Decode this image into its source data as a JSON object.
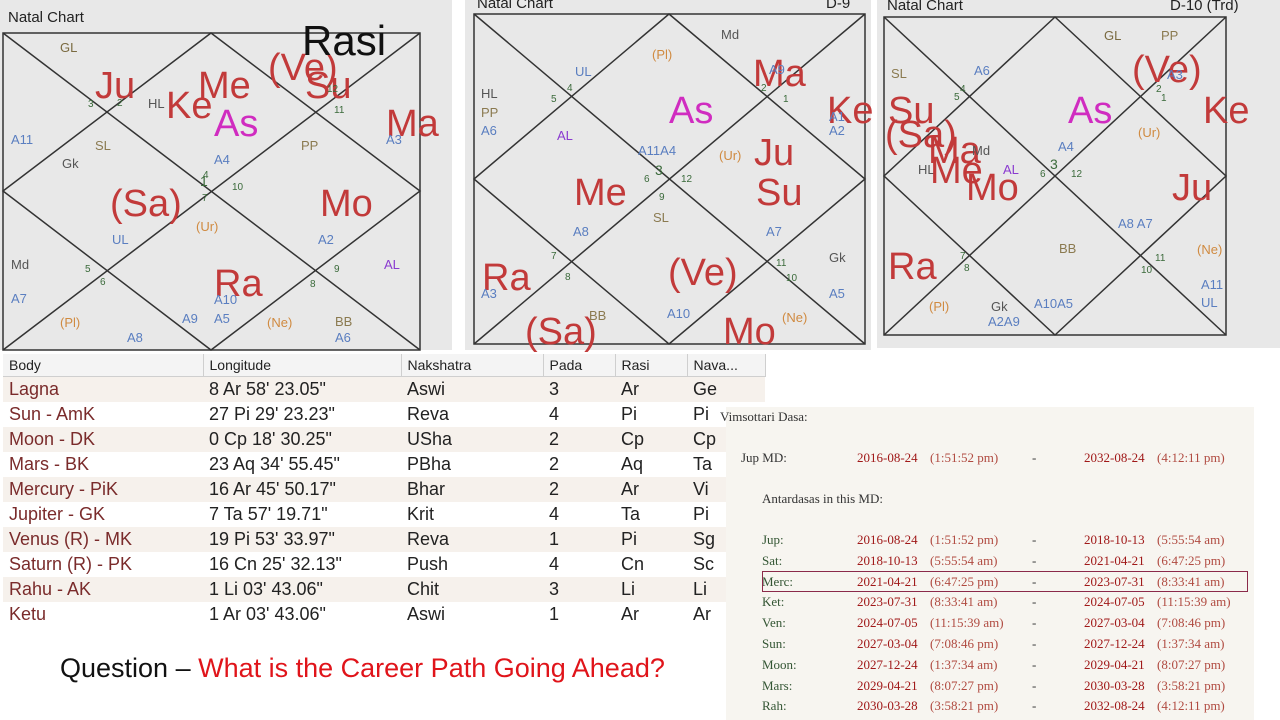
{
  "chart1": {
    "title": "Natal Chart",
    "label": "Rasi",
    "text": [
      {
        "t": "GL",
        "c": "#7a6a40",
        "s": 13
      },
      {
        "t": "Ju",
        "c": "#c23a3a",
        "s": 38
      },
      {
        "t": "Ke",
        "c": "#c23a3a",
        "s": 38
      },
      {
        "t": "Me",
        "c": "#c23a3a",
        "s": 38
      },
      {
        "t": "(Ve)",
        "c": "#c23a3a",
        "s": 38
      },
      {
        "t": "Su",
        "c": "#c23a3a",
        "s": 38
      },
      {
        "t": "As",
        "c": "#d02cc0",
        "s": 38
      },
      {
        "t": "HL",
        "c": "#555555",
        "s": 13
      },
      {
        "t": "3",
        "c": "#3a6a3a",
        "s": 10
      },
      {
        "t": "2",
        "c": "#3a6a3a",
        "s": 10
      },
      {
        "t": "12",
        "c": "#3a6a3a",
        "s": 10
      },
      {
        "t": "11",
        "c": "#3a6a3a",
        "s": 10
      },
      {
        "t": "Ma",
        "c": "#c23a3a",
        "s": 38
      },
      {
        "t": "A3",
        "c": "#5a7ec0",
        "s": 13
      },
      {
        "t": "A11",
        "c": "#5a7ec0",
        "s": 13
      },
      {
        "t": "SL",
        "c": "#8b7a50",
        "s": 13
      },
      {
        "t": "Gk",
        "c": "#555555",
        "s": 13
      },
      {
        "t": "A4",
        "c": "#5a7ec0",
        "s": 13
      },
      {
        "t": "PP",
        "c": "#8b7a50",
        "s": 13
      },
      {
        "t": "1",
        "c": "#3a6a3a",
        "s": 14
      },
      {
        "t": "4",
        "c": "#3a6a3a",
        "s": 10
      },
      {
        "t": "10",
        "c": "#3a6a3a",
        "s": 10
      },
      {
        "t": "7",
        "c": "#3a6a3a",
        "s": 10
      },
      {
        "t": "(Sa)",
        "c": "#c23a3a",
        "s": 38
      },
      {
        "t": "Mo",
        "c": "#c23a3a",
        "s": 38
      },
      {
        "t": "(Ur)",
        "c": "#d08a40",
        "s": 13
      },
      {
        "t": "UL",
        "c": "#5a7ec0",
        "s": 13
      },
      {
        "t": "A2",
        "c": "#5a7ec0",
        "s": 13
      },
      {
        "t": "Md",
        "c": "#555555",
        "s": 13
      },
      {
        "t": "5",
        "c": "#3a6a3a",
        "s": 10
      },
      {
        "t": "6",
        "c": "#3a6a3a",
        "s": 10
      },
      {
        "t": "Ra",
        "c": "#c23a3a",
        "s": 38
      },
      {
        "t": "8",
        "c": "#3a6a3a",
        "s": 10
      },
      {
        "t": "9",
        "c": "#3a6a3a",
        "s": 10
      },
      {
        "t": "AL",
        "c": "#8a3ad0",
        "s": 13
      },
      {
        "t": "A7",
        "c": "#5a7ec0",
        "s": 13
      },
      {
        "t": "A10",
        "c": "#5a7ec0",
        "s": 13
      },
      {
        "t": "(Pl)",
        "c": "#d08a40",
        "s": 13
      },
      {
        "t": "A9",
        "c": "#5a7ec0",
        "s": 13
      },
      {
        "t": "A5",
        "c": "#5a7ec0",
        "s": 13
      },
      {
        "t": "(Ne)",
        "c": "#d08a40",
        "s": 13
      },
      {
        "t": "BB",
        "c": "#8b7a50",
        "s": 13
      },
      {
        "t": "A8",
        "c": "#5a7ec0",
        "s": 13
      },
      {
        "t": "A6",
        "c": "#5a7ec0",
        "s": 13
      }
    ]
  },
  "chart2": {
    "title": "Natal Chart",
    "label": "D-9",
    "text": [
      {
        "t": "Md",
        "c": "#555555",
        "s": 13
      },
      {
        "t": "(Pl)",
        "c": "#d08a40",
        "s": 13
      },
      {
        "t": "Ma",
        "c": "#c23a3a",
        "s": 38
      },
      {
        "t": "A9",
        "c": "#5a7ec0",
        "s": 13
      },
      {
        "t": "UL",
        "c": "#5a7ec0",
        "s": 13
      },
      {
        "t": "HL",
        "c": "#555555",
        "s": 13
      },
      {
        "t": "PP",
        "c": "#8b7a50",
        "s": 13
      },
      {
        "t": "A6",
        "c": "#5a7ec0",
        "s": 13
      },
      {
        "t": "5",
        "c": "#3a6a3a",
        "s": 10
      },
      {
        "t": "4",
        "c": "#3a6a3a",
        "s": 10
      },
      {
        "t": "2",
        "c": "#3a6a3a",
        "s": 10
      },
      {
        "t": "1",
        "c": "#3a6a3a",
        "s": 10
      },
      {
        "t": "As",
        "c": "#d02cc0",
        "s": 38
      },
      {
        "t": "Ke",
        "c": "#c23a3a",
        "s": 38
      },
      {
        "t": "A1",
        "c": "#5a7ec0",
        "s": 13
      },
      {
        "t": "A2",
        "c": "#5a7ec0",
        "s": 13
      },
      {
        "t": "AL",
        "c": "#8a3ad0",
        "s": 13
      },
      {
        "t": "A11A4",
        "c": "#5a7ec0",
        "s": 13
      },
      {
        "t": "(Ur)",
        "c": "#d08a40",
        "s": 13
      },
      {
        "t": "Ju",
        "c": "#c23a3a",
        "s": 38
      },
      {
        "t": "Me",
        "c": "#c23a3a",
        "s": 38
      },
      {
        "t": "6",
        "c": "#3a6a3a",
        "s": 10
      },
      {
        "t": "3",
        "c": "#3a6a3a",
        "s": 14
      },
      {
        "t": "12",
        "c": "#3a6a3a",
        "s": 10
      },
      {
        "t": "Su",
        "c": "#c23a3a",
        "s": 38
      },
      {
        "t": "9",
        "c": "#3a6a3a",
        "s": 10
      },
      {
        "t": "SL",
        "c": "#8b7a50",
        "s": 13
      },
      {
        "t": "A8",
        "c": "#5a7ec0",
        "s": 13
      },
      {
        "t": "A7",
        "c": "#5a7ec0",
        "s": 13
      },
      {
        "t": "Ra",
        "c": "#c23a3a",
        "s": 38
      },
      {
        "t": "7",
        "c": "#3a6a3a",
        "s": 10
      },
      {
        "t": "8",
        "c": "#3a6a3a",
        "s": 10
      },
      {
        "t": "(Ve)",
        "c": "#c23a3a",
        "s": 38
      },
      {
        "t": "11",
        "c": "#3a6a3a",
        "s": 10
      },
      {
        "t": "10",
        "c": "#3a6a3a",
        "s": 10
      },
      {
        "t": "Gk",
        "c": "#555555",
        "s": 13
      },
      {
        "t": "A3",
        "c": "#5a7ec0",
        "s": 13
      },
      {
        "t": "A5",
        "c": "#5a7ec0",
        "s": 13
      },
      {
        "t": "A10",
        "c": "#5a7ec0",
        "s": 13
      },
      {
        "t": "(Sa)",
        "c": "#c23a3a",
        "s": 38
      },
      {
        "t": "BB",
        "c": "#8b7a50",
        "s": 13
      },
      {
        "t": "Mo",
        "c": "#c23a3a",
        "s": 38
      },
      {
        "t": "(Ne)",
        "c": "#d08a40",
        "s": 13
      }
    ]
  },
  "chart3": {
    "title": "Natal Chart",
    "label": "D-10 (Trd)",
    "text": [
      {
        "t": "GL",
        "c": "#7a6a40",
        "s": 13
      },
      {
        "t": "PP",
        "c": "#8b7a50",
        "s": 13
      },
      {
        "t": "SL",
        "c": "#8b7a50",
        "s": 13
      },
      {
        "t": "A6",
        "c": "#5a7ec0",
        "s": 13
      },
      {
        "t": "(Ve)",
        "c": "#c23a3a",
        "s": 38
      },
      {
        "t": "A3",
        "c": "#5a7ec0",
        "s": 13
      },
      {
        "t": "5",
        "c": "#3a6a3a",
        "s": 10
      },
      {
        "t": "4",
        "c": "#3a6a3a",
        "s": 10
      },
      {
        "t": "2",
        "c": "#3a6a3a",
        "s": 10
      },
      {
        "t": "1",
        "c": "#3a6a3a",
        "s": 10
      },
      {
        "t": "As",
        "c": "#d02cc0",
        "s": 38
      },
      {
        "t": "Ke",
        "c": "#c23a3a",
        "s": 38
      },
      {
        "t": "Su",
        "c": "#c23a3a",
        "s": 38
      },
      {
        "t": "(Sa)",
        "c": "#c23a3a",
        "s": 38
      },
      {
        "t": "(Ur)",
        "c": "#d08a40",
        "s": 13
      },
      {
        "t": "Ma",
        "c": "#c23a3a",
        "s": 38
      },
      {
        "t": "Md",
        "c": "#555555",
        "s": 13
      },
      {
        "t": "A4",
        "c": "#5a7ec0",
        "s": 13
      },
      {
        "t": "HL",
        "c": "#555555",
        "s": 13
      },
      {
        "t": "Me",
        "c": "#c23a3a",
        "s": 38
      },
      {
        "t": "Mo",
        "c": "#c23a3a",
        "s": 38
      },
      {
        "t": "AL",
        "c": "#8a3ad0",
        "s": 13
      },
      {
        "t": "6",
        "c": "#3a6a3a",
        "s": 10
      },
      {
        "t": "3",
        "c": "#3a6a3a",
        "s": 14
      },
      {
        "t": "12",
        "c": "#3a6a3a",
        "s": 10
      },
      {
        "t": "Ju",
        "c": "#c23a3a",
        "s": 38
      },
      {
        "t": "A8 A7",
        "c": "#5a7ec0",
        "s": 13
      },
      {
        "t": "BB",
        "c": "#8b7a50",
        "s": 13
      },
      {
        "t": "Ra",
        "c": "#c23a3a",
        "s": 38
      },
      {
        "t": "7",
        "c": "#3a6a3a",
        "s": 10
      },
      {
        "t": "8",
        "c": "#3a6a3a",
        "s": 10
      },
      {
        "t": "10",
        "c": "#3a6a3a",
        "s": 10
      },
      {
        "t": "11",
        "c": "#3a6a3a",
        "s": 10
      },
      {
        "t": "(Ne)",
        "c": "#d08a40",
        "s": 13
      },
      {
        "t": "A11",
        "c": "#5a7ec0",
        "s": 13
      },
      {
        "t": "UL",
        "c": "#5a7ec0",
        "s": 13
      },
      {
        "t": "(Pl)",
        "c": "#d08a40",
        "s": 13
      },
      {
        "t": "Gk",
        "c": "#555555",
        "s": 13
      },
      {
        "t": "A2A9",
        "c": "#5a7ec0",
        "s": 13
      },
      {
        "t": "A10A5",
        "c": "#5a7ec0",
        "s": 13
      }
    ]
  },
  "table": {
    "headers": [
      "Body",
      "Longitude",
      "Nakshatra",
      "Pada",
      "Rasi",
      "Nava..."
    ],
    "rows": [
      [
        "Lagna",
        "8 Ar 58' 23.05\"",
        "Aswi",
        "3",
        "Ar",
        "Ge"
      ],
      [
        "Sun - AmK",
        "27 Pi 29' 23.23\"",
        "Reva",
        "4",
        "Pi",
        "Pi"
      ],
      [
        "Moon - DK",
        "0 Cp 18' 30.25\"",
        "USha",
        "2",
        "Cp",
        "Cp"
      ],
      [
        "Mars - BK",
        "23 Aq 34' 55.45\"",
        "PBha",
        "2",
        "Aq",
        "Ta"
      ],
      [
        "Mercury - PiK",
        "16 Ar 45' 50.17\"",
        "Bhar",
        "2",
        "Ar",
        "Vi"
      ],
      [
        "Jupiter - GK",
        "7 Ta 57' 19.71\"",
        "Krit",
        "4",
        "Ta",
        "Pi"
      ],
      [
        "Venus (R) - MK",
        "19 Pi 53' 33.97\"",
        "Reva",
        "1",
        "Pi",
        "Sg"
      ],
      [
        "Saturn (R) - PK",
        "16 Cn 25' 32.13\"",
        "Push",
        "4",
        "Cn",
        "Sc"
      ],
      [
        "Rahu - AK",
        "1 Li 03' 43.06\"",
        "Chit",
        "3",
        "Li",
        "Li"
      ],
      [
        "Ketu",
        "1 Ar 03' 43.06\"",
        "Aswi",
        "1",
        "Ar",
        "Ar"
      ]
    ]
  },
  "question": {
    "prefix": "Question – ",
    "text": "What is the Career Path Going Ahead?"
  },
  "dasa": {
    "title": "Vimsottari Dasa:",
    "md": [
      "Jup MD:",
      "2016-08-24",
      "(1:51:52 pm)",
      "-",
      "2032-08-24",
      "(4:12:11 pm)"
    ],
    "subtitle": "Antardasas in this MD:",
    "rows": [
      [
        "Jup:",
        "2016-08-24",
        "(1:51:52 pm)",
        "-",
        "2018-10-13",
        "(5:55:54 am)"
      ],
      [
        "Sat:",
        "2018-10-13",
        "(5:55:54 am)",
        "-",
        "2021-04-21",
        "(6:47:25 pm)"
      ],
      [
        "Merc:",
        "2021-04-21",
        "(6:47:25 pm)",
        "-",
        "2023-07-31",
        "(8:33:41 am)"
      ],
      [
        "Ket:",
        "2023-07-31",
        "(8:33:41 am)",
        "-",
        "2024-07-05",
        "(11:15:39 am)"
      ],
      [
        "Ven:",
        "2024-07-05",
        "(11:15:39 am)",
        "-",
        "2027-03-04",
        "(7:08:46 pm)"
      ],
      [
        "Sun:",
        "2027-03-04",
        "(7:08:46 pm)",
        "-",
        "2027-12-24",
        "(1:37:34 am)"
      ],
      [
        "Moon:",
        "2027-12-24",
        "(1:37:34 am)",
        "-",
        "2029-04-21",
        "(8:07:27 pm)"
      ],
      [
        "Mars:",
        "2029-04-21",
        "(8:07:27 pm)",
        "-",
        "2030-03-28",
        "(3:58:21 pm)"
      ],
      [
        "Rah:",
        "2030-03-28",
        "(3:58:21 pm)",
        "-",
        "2032-08-24",
        "(4:12:11 pm)"
      ]
    ]
  }
}
